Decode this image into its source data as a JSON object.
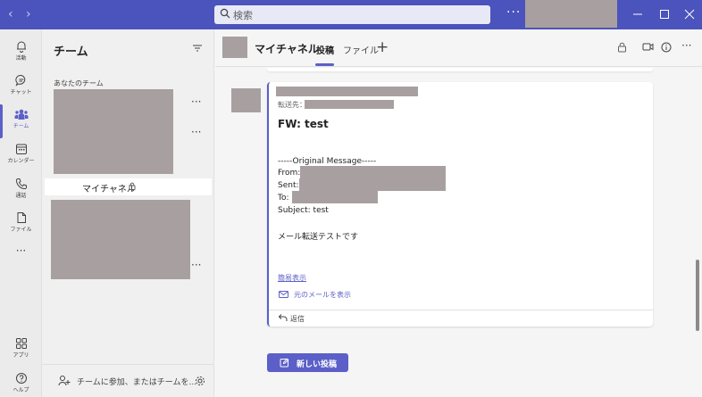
{
  "titlebar": {
    "back_icon": "chevron-left-icon",
    "forward_icon": "chevron-right-icon",
    "search_placeholder": "検索",
    "more_label": "···"
  },
  "rail": {
    "items": [
      {
        "label": "活動",
        "icon": "bell-icon"
      },
      {
        "label": "チャット",
        "icon": "chat-icon"
      },
      {
        "label": "チーム",
        "icon": "teams-icon"
      },
      {
        "label": "カレンダー",
        "icon": "calendar-icon"
      },
      {
        "label": "通話",
        "icon": "phone-icon"
      },
      {
        "label": "ファイル",
        "icon": "file-icon"
      },
      {
        "label": "···",
        "icon": "more-icon"
      },
      {
        "label": "アプリ",
        "icon": "apps-icon"
      },
      {
        "label": "ヘルプ",
        "icon": "help-icon"
      }
    ],
    "active_index": 2
  },
  "teams_pane": {
    "title": "チーム",
    "section_label": "あなたのチーム",
    "channel_name": "マイチャネル",
    "more": "···",
    "join_text": "チームに参加、またはチームを..."
  },
  "header": {
    "channel_name": "マイチャネル",
    "tabs": [
      "投稿",
      "ファイル"
    ],
    "add_tab": "+",
    "more": "···"
  },
  "post": {
    "forward_label": "転送先：",
    "subject": "FW: test",
    "original_header": "-----Original Message-----",
    "from_label": "From:",
    "sent_label": "Sent:",
    "to_label": "To:",
    "subject_line": "Subject: test",
    "body": "メール転送テストです",
    "summary_link": "簡易表示",
    "view_original": "元のメールを表示",
    "reply": "返信"
  },
  "new_post_button": "新しい投稿",
  "colors": {
    "brand": "#4b53bc",
    "accent": "#5b5fc7",
    "redaction": "#a8a0a0"
  }
}
